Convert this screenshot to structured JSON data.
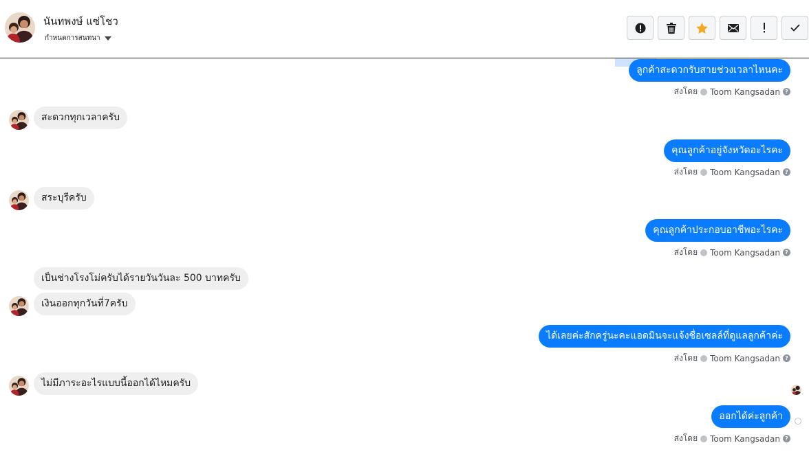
{
  "header": {
    "contact_name": "นันทพงษ์ แซ่โชว",
    "assign_label": "กำหนดการสนทนา"
  },
  "toolbar": {
    "buttons": [
      {
        "name": "spam-button",
        "icon": "alert-circle-icon"
      },
      {
        "name": "delete-button",
        "icon": "trash-icon"
      },
      {
        "name": "star-button",
        "icon": "star-icon",
        "color": "#f5a623"
      },
      {
        "name": "mark-unread-button",
        "icon": "envelope-icon"
      },
      {
        "name": "follow-up-button",
        "icon": "exclamation-icon"
      },
      {
        "name": "mark-done-button",
        "icon": "check-icon"
      }
    ]
  },
  "colors": {
    "outgoing_bubble": "#0a7cff",
    "incoming_bubble": "#efefef"
  },
  "sender_prefix": "ส่งโดย",
  "sender_name": "Toom Kangsadan",
  "messages": [
    {
      "dir": "out",
      "text": "ลูกค้าสะดวกรับสายช่วงเวลาไหนคะ"
    },
    {
      "dir": "in",
      "text": "สะดวกทุกเวลาครับ"
    },
    {
      "dir": "out",
      "text": "คุณลูกค้าอยู่จังหวัดอะไรคะ"
    },
    {
      "dir": "in",
      "text": "สระบุรีครับ"
    },
    {
      "dir": "out",
      "text": "คุณลูกค้าประกอบอาชีพอะไรคะ"
    },
    {
      "dir": "in",
      "text": "เป็นช่างโรงโม่ครับได้รายวันวันละ 500 บาทครับ"
    },
    {
      "dir": "in",
      "text": "เงินออกทุกวันที่7ครับ"
    },
    {
      "dir": "out",
      "text": "ได้เลยค่ะสักครู่นะคะแอดมินจะแจ้งชื่อเซลล์ที่ดูแลลูกค้าค่ะ"
    },
    {
      "dir": "in",
      "text": "ไม่มีภาระอะไรแบบนี้ออกได้ไหมครับ"
    },
    {
      "dir": "out",
      "text": "ออกได้ค่ะลูกค้า"
    }
  ]
}
